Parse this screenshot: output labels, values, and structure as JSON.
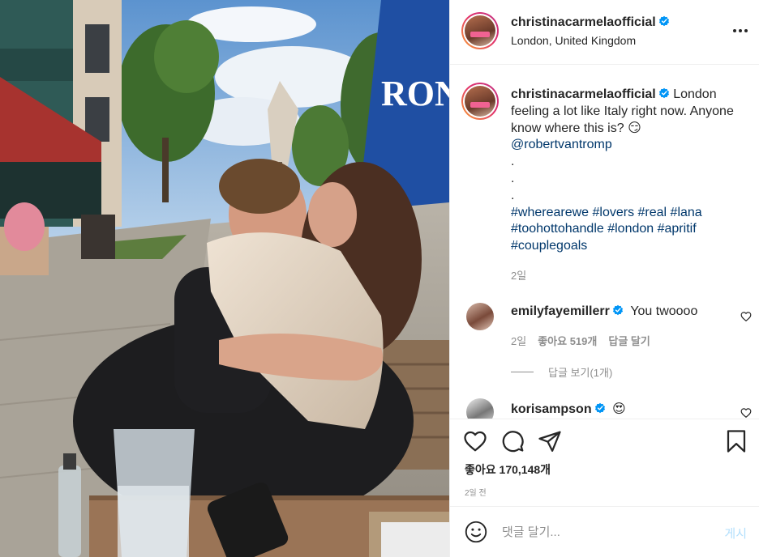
{
  "post": {
    "author": "christinacarmelaofficial",
    "location": "London, United Kingdom",
    "photo_alt": "Photo by christinacarmelaofficial"
  },
  "caption": {
    "author": "christinacarmelaofficial",
    "text": "London feeling a lot like Italy right now. Anyone know where this is? 😏",
    "mention": "@robertvantromp",
    "dots": [
      ".",
      ".",
      "."
    ],
    "hashtags_line1": "#wherearewe #lovers #real #lana",
    "hashtags_line2": "#toohottohandle #london #apritif",
    "hashtags_line3": "#couplegoals",
    "time": "2일"
  },
  "comments": [
    {
      "author": "emilyfayemillerr",
      "text": "You twoooo",
      "time": "2일",
      "likes": "좋아요 519개",
      "reply": "답글 달기",
      "view_replies": "답글 보기(1개)"
    },
    {
      "author": "korisampson",
      "text": "😍"
    }
  ],
  "actions": {
    "like_icon": "heart-icon",
    "comment_icon": "comment-icon",
    "share_icon": "share-icon",
    "save_icon": "bookmark-icon",
    "likes_label": "좋아요 170,148개",
    "posted": "2일 전"
  },
  "composer": {
    "placeholder": "댓글 달기...",
    "post_label": "게시"
  },
  "colors": {
    "link": "#00376b",
    "verified": "#0095f6",
    "muted": "#8e8e8e",
    "post_button_disabled": "#b2dffc"
  }
}
